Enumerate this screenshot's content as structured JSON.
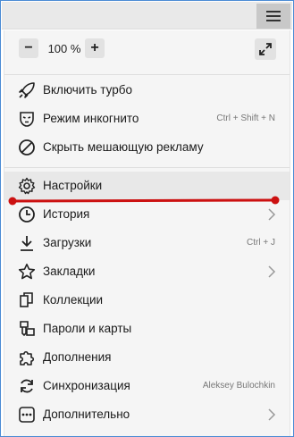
{
  "zoom": {
    "minus_label": "−",
    "value": "100 %",
    "plus_label": "+"
  },
  "menu": {
    "items": [
      {
        "label": "Включить турбо",
        "icon": "rocket-icon"
      },
      {
        "label": "Режим инкогнито",
        "icon": "incognito-mask-icon",
        "hint": "Ctrl + Shift + N"
      },
      {
        "label": "Скрыть мешающую рекламу",
        "icon": "block-icon"
      },
      {
        "label": "Настройки",
        "icon": "gear-icon"
      },
      {
        "label": "История",
        "icon": "clock-icon"
      },
      {
        "label": "Загрузки",
        "icon": "download-icon",
        "hint": "Ctrl + J"
      },
      {
        "label": "Закладки",
        "icon": "star-icon"
      },
      {
        "label": "Коллекции",
        "icon": "collections-icon"
      },
      {
        "label": "Пароли и карты",
        "icon": "passwords-cards-icon"
      },
      {
        "label": "Дополнения",
        "icon": "puzzle-icon"
      },
      {
        "label": "Синхронизация",
        "icon": "sync-icon",
        "hint": "Aleksey Bulochkin"
      },
      {
        "label": "Дополнительно",
        "icon": "more-icon"
      }
    ]
  },
  "colors": {
    "annotation_red": "#cc1111",
    "highlight": "#e8e8e8",
    "panel_bg": "#f5f5f5"
  }
}
